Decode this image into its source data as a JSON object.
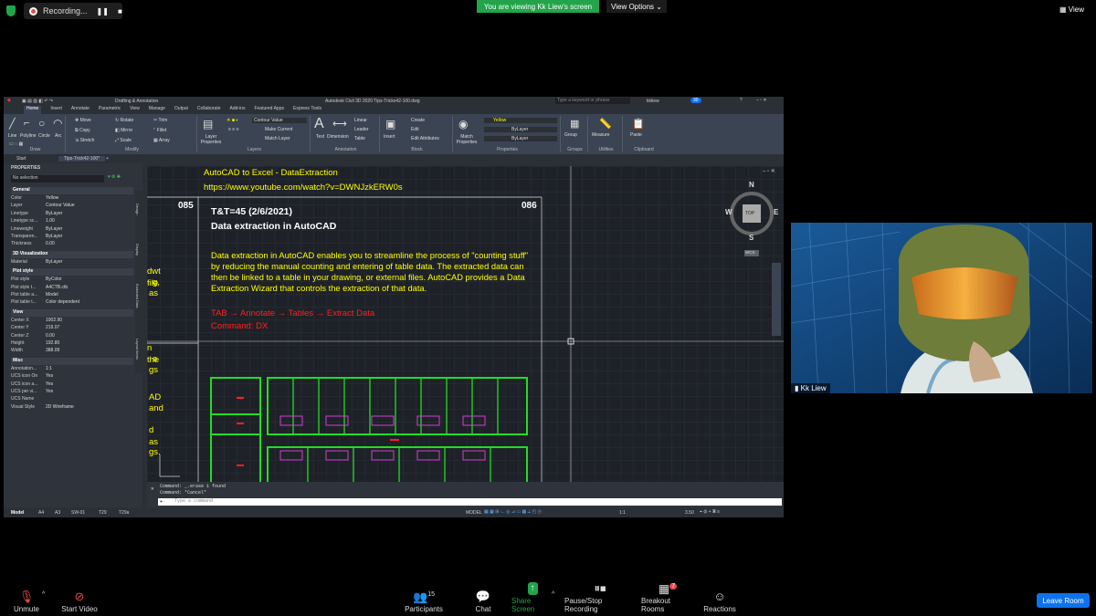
{
  "zoom_top": {
    "recording_label": "Recording...",
    "viewing_banner": "You are viewing Kk Liew's screen",
    "view_options": "View Options",
    "view_label": "View"
  },
  "acad": {
    "title": "Autodesk Civil 3D 2020   Tips-Tricks42-100.dwg",
    "workspace": "Drafting & Annotation",
    "search_placeholder": "Type a keyword or phrase",
    "user": "kkliew",
    "ribbon_tabs": [
      "Home",
      "Insert",
      "Annotate",
      "Parametric",
      "View",
      "Manage",
      "Output",
      "Collaborate",
      "Add-ins",
      "Featured Apps",
      "Express Tools"
    ],
    "draw_group": {
      "label": "Draw",
      "tools": [
        "Line",
        "Polyline",
        "Circle",
        "Arc"
      ]
    },
    "modify_group": {
      "label": "Modify",
      "tools": [
        "Move",
        "Rotate",
        "Trim",
        "Copy",
        "Mirror",
        "Fillet",
        "Stretch",
        "Scale",
        "Array"
      ]
    },
    "layers_group": {
      "label": "Layers",
      "layer_props": "Layer Properties",
      "current": "Contour Value",
      "make_current": "Make Current",
      "match_layer": "Match Layer"
    },
    "annotation_group": {
      "label": "Annotation",
      "text": "Text",
      "dimension": "Dimension",
      "linear": "Linear",
      "leader": "Leader",
      "table": "Table"
    },
    "block_group": {
      "label": "Block",
      "insert": "Insert",
      "create": "Create",
      "edit": "Edit",
      "edit_attributes": "Edit Attributes"
    },
    "properties_group": {
      "label": "Properties",
      "match": "Match Properties",
      "color": "Yellow",
      "linetype": "ByLayer",
      "lineweight": "ByLayer"
    },
    "groups_group": {
      "label": "Groups",
      "group": "Group"
    },
    "utilities_group": {
      "label": "Utilities",
      "measure": "Measure"
    },
    "clipboard_group": {
      "label": "Clipboard",
      "paste": "Paste"
    },
    "doc_tabs": [
      "Start",
      "Tips-Trick42-100*"
    ],
    "properties_palette": {
      "title": "PROPERTIES",
      "selection": "No selection",
      "sections": [
        {
          "name": "General",
          "rows": [
            [
              "Color",
              "Yellow"
            ],
            [
              "Layer",
              "Contour Value"
            ],
            [
              "Linetype",
              "ByLayer"
            ],
            [
              "Linetype sc...",
              "1.00"
            ],
            [
              "Lineweight",
              "ByLayer"
            ],
            [
              "Transparen...",
              "ByLayer"
            ],
            [
              "Thickness",
              "0.00"
            ]
          ]
        },
        {
          "name": "3D Visualization",
          "rows": [
            [
              "Material",
              "ByLayer"
            ]
          ]
        },
        {
          "name": "Plot style",
          "rows": [
            [
              "Plot style",
              "ByColor"
            ],
            [
              "Plot style t...",
              "A4CTB.ctb"
            ],
            [
              "Plot table a...",
              "Model"
            ],
            [
              "Plot table t...",
              "Color dependent"
            ]
          ]
        },
        {
          "name": "View",
          "rows": [
            [
              "Center X",
              "1002.90"
            ],
            [
              "Center Y",
              "219.07"
            ],
            [
              "Center Z",
              "0.00"
            ],
            [
              "Height",
              "192.80"
            ],
            [
              "Width",
              "388.09"
            ]
          ]
        },
        {
          "name": "Misc",
          "rows": [
            [
              "Annotation...",
              "1:1"
            ],
            [
              "UCS icon On",
              "Yes"
            ],
            [
              "UCS icon a...",
              "Yes"
            ],
            [
              "UCS per vi...",
              "Yes"
            ],
            [
              "UCS Name",
              ""
            ],
            [
              "Visual Style",
              "2D Wireframe"
            ]
          ]
        }
      ],
      "side_tabs": [
        "Design",
        "Display",
        "Extended Data",
        "Layout Items"
      ]
    },
    "drawing": {
      "top_line1": "AutoCAD to Excel - DataExtraction",
      "top_line2": "https://www.youtube.com/watch?v=DWNJzkERW0s",
      "num_left": "085",
      "num_right": "086",
      "heading1": "T&T=45 (2/6/2021)",
      "heading2": "Data extraction in AutoCAD",
      "paragraph": "Data extraction in AutoCAD enables you to streamline the process of \"counting stuff\" by reducing the manual counting and entering of table data. The extracted data can then be linked to a table in your drawing, or external files. AutoCAD provides a Data Extraction Wizard that controls the extraction of that data.",
      "path_text": "TAB  →  Annotate  →  Tables  →  Extract Data",
      "command_text": "Command: DX",
      "left_fragments": [
        "dwt file",
        "g,",
        "as",
        "n the",
        "e",
        "gs",
        "AD",
        "and",
        "d as",
        "gs."
      ],
      "compass": {
        "n": "N",
        "s": "S",
        "e": "E",
        "w": "W",
        "top": "TOP",
        "ucs": "WCS"
      }
    },
    "command_history": [
      "Command: _.erase 1 found",
      "Command: *Cancel*"
    ],
    "command_prompt": "Type a command",
    "layout_tabs": [
      "Model",
      "A4",
      "A3",
      "SW-01",
      "T29",
      "T29a"
    ],
    "status": {
      "model": "MODEL",
      "scale": "1:1",
      "value": "3.50"
    }
  },
  "webcam": {
    "name": "Kk Liew"
  },
  "zoom_bottom": {
    "unmute": "Unmute",
    "start_video": "Start Video",
    "participants": "Participants",
    "participants_count": "15",
    "chat": "Chat",
    "share_screen": "Share Screen",
    "pause_recording": "Pause/Stop Recording",
    "breakout_rooms": "Breakout Rooms",
    "breakout_badge": "7",
    "reactions": "Reactions",
    "leave": "Leave Room"
  },
  "colors": {
    "zoom_green": "#23a44a",
    "leave_blue": "#0e72ed",
    "draw_yellow": "#ffff00",
    "draw_red": "#ff2020",
    "draw_green": "#22dd22"
  }
}
